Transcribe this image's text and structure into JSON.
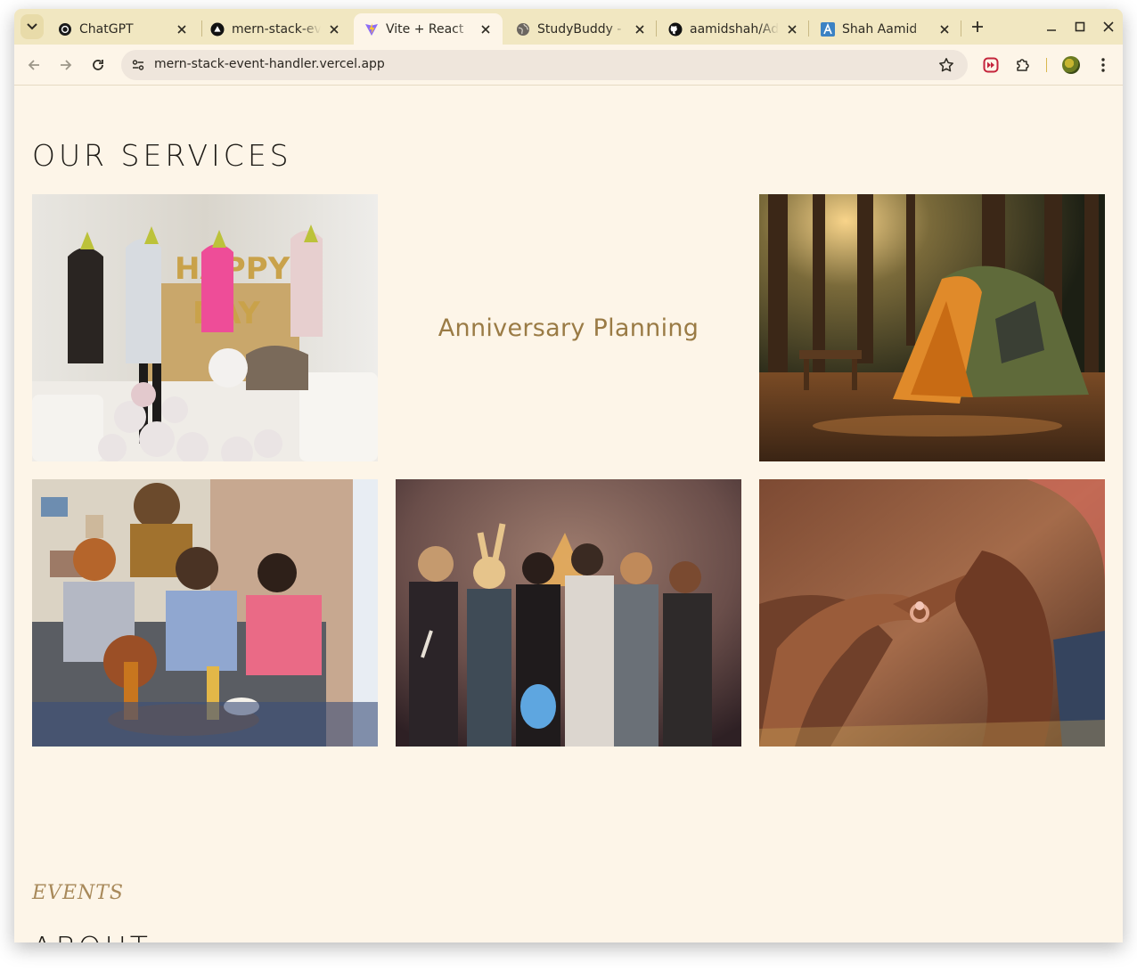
{
  "browser": {
    "tabs": [
      {
        "title": "ChatGPT",
        "icon": "openai-icon",
        "active": false
      },
      {
        "title": "mern-stack-eve",
        "icon": "vercel-icon",
        "active": false
      },
      {
        "title": "Vite + React",
        "icon": "vite-icon",
        "active": true
      },
      {
        "title": "StudyBuddy - F",
        "icon": "globe-icon",
        "active": false
      },
      {
        "title": "aamidshah/Ad",
        "icon": "github-icon",
        "active": false
      },
      {
        "title": "Shah Aamid",
        "icon": "letter-a-icon",
        "active": false
      }
    ],
    "url": "mern-stack-event-handler.vercel.app",
    "accent_color": "#f1e7c1"
  },
  "page": {
    "section_title": "OUR SERVICES",
    "cards": [
      {
        "type": "image",
        "icon": "birthday-party-photo"
      },
      {
        "type": "text",
        "label": "Anniversary Planning"
      },
      {
        "type": "image",
        "icon": "camping-tent-photo"
      },
      {
        "type": "image",
        "icon": "game-night-photo"
      },
      {
        "type": "image",
        "icon": "group-party-photo"
      },
      {
        "type": "image",
        "icon": "engagement-ring-photo"
      }
    ],
    "events_label": "EVENTS",
    "about_title": "ABOUT",
    "text_accent": "#9a7b45",
    "background": "#fdf5e8"
  }
}
